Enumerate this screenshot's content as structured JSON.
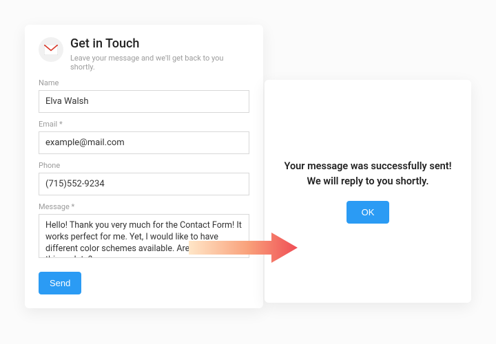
{
  "form": {
    "title": "Get in Touch",
    "subtitle": "Leave your message and we'll get back to you shortly.",
    "name": {
      "label": "Name",
      "value": "Elva Walsh"
    },
    "email": {
      "label": "Email *",
      "value": "example@mail.com"
    },
    "phone": {
      "label": "Phone",
      "value": "(715)552-9234"
    },
    "message": {
      "label": "Message *",
      "value": "Hello! Thank you very much for the Contact Form! It works perfect for me. Yet, I would like to have different color schemes available. Are you planning this update?"
    },
    "send_label": "Send"
  },
  "confirmation": {
    "text": "Your message was successfully sent! We will reply to you shortly.",
    "ok_label": "OK"
  }
}
